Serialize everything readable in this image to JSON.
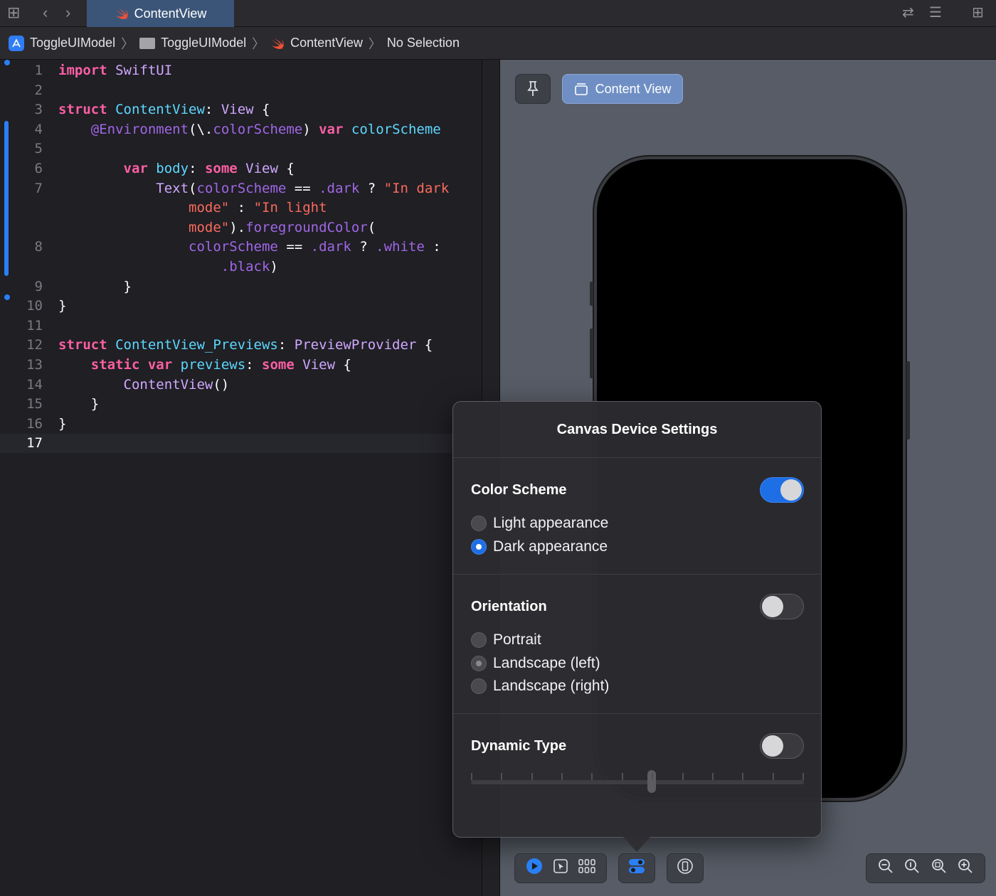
{
  "tabbar": {
    "active_tab": "ContentView"
  },
  "breadcrumb": {
    "items": [
      "ToggleUIModel",
      "ToggleUIModel",
      "ContentView",
      "No Selection"
    ]
  },
  "editor": {
    "line_numbers": [
      "1",
      "2",
      "3",
      "4",
      "5",
      "6",
      "7",
      "8",
      "9",
      "10",
      "11",
      "12",
      "13",
      "14",
      "15",
      "16",
      "17"
    ],
    "lines": [
      [
        "import",
        " SwiftUI"
      ],
      [],
      [
        "struct",
        " ContentView",
        ": ",
        "View",
        " {"
      ],
      [
        "    ",
        "@Environment",
        "(\\.",
        "colorScheme",
        ") ",
        "var",
        " ",
        "colorScheme"
      ],
      [],
      [
        "        ",
        "var",
        " ",
        "body",
        ": ",
        "some",
        " ",
        "View",
        " {"
      ],
      [
        "            ",
        "Text",
        "(",
        "colorScheme",
        " == ",
        ".dark",
        " ? ",
        "\"In dark"
      ],
      [
        "                ",
        "mode\"",
        " : ",
        "\"In light"
      ],
      [
        "                ",
        "mode\"",
        ").",
        "foregroundColor",
        "("
      ],
      [
        "                ",
        "colorScheme",
        " == ",
        ".dark",
        " ? ",
        ".white",
        " :"
      ],
      [
        "                    ",
        ".black",
        ")"
      ],
      [
        "        }"
      ],
      [
        "}"
      ],
      [],
      [
        "struct",
        " ",
        "ContentView_Previews",
        ": ",
        "PreviewProvider",
        " {"
      ],
      [
        "    ",
        "static",
        " ",
        "var",
        " ",
        "previews",
        ": ",
        "some",
        " ",
        "View",
        " {"
      ],
      [
        "        ",
        "ContentView",
        "()"
      ],
      [
        "    }"
      ],
      [
        "}"
      ],
      []
    ]
  },
  "canvas": {
    "preview_button": "Content View"
  },
  "popover": {
    "title": "Canvas Device Settings",
    "color_scheme": {
      "heading": "Color Scheme",
      "enabled": true,
      "options": [
        "Light appearance",
        "Dark appearance"
      ],
      "selected": "Dark appearance"
    },
    "orientation": {
      "heading": "Orientation",
      "enabled": false,
      "options": [
        "Portrait",
        "Landscape (left)",
        "Landscape (right)"
      ],
      "selected": "Landscape (left)"
    },
    "dynamic_type": {
      "heading": "Dynamic Type",
      "enabled": false,
      "steps": 12,
      "value_step": 6
    }
  },
  "colors": {
    "accent": "#1e6ee6",
    "keyword": "#fc5fa3",
    "string": "#fc6a5d",
    "declaration": "#5dd8ff",
    "type": "#d0a8ff"
  }
}
